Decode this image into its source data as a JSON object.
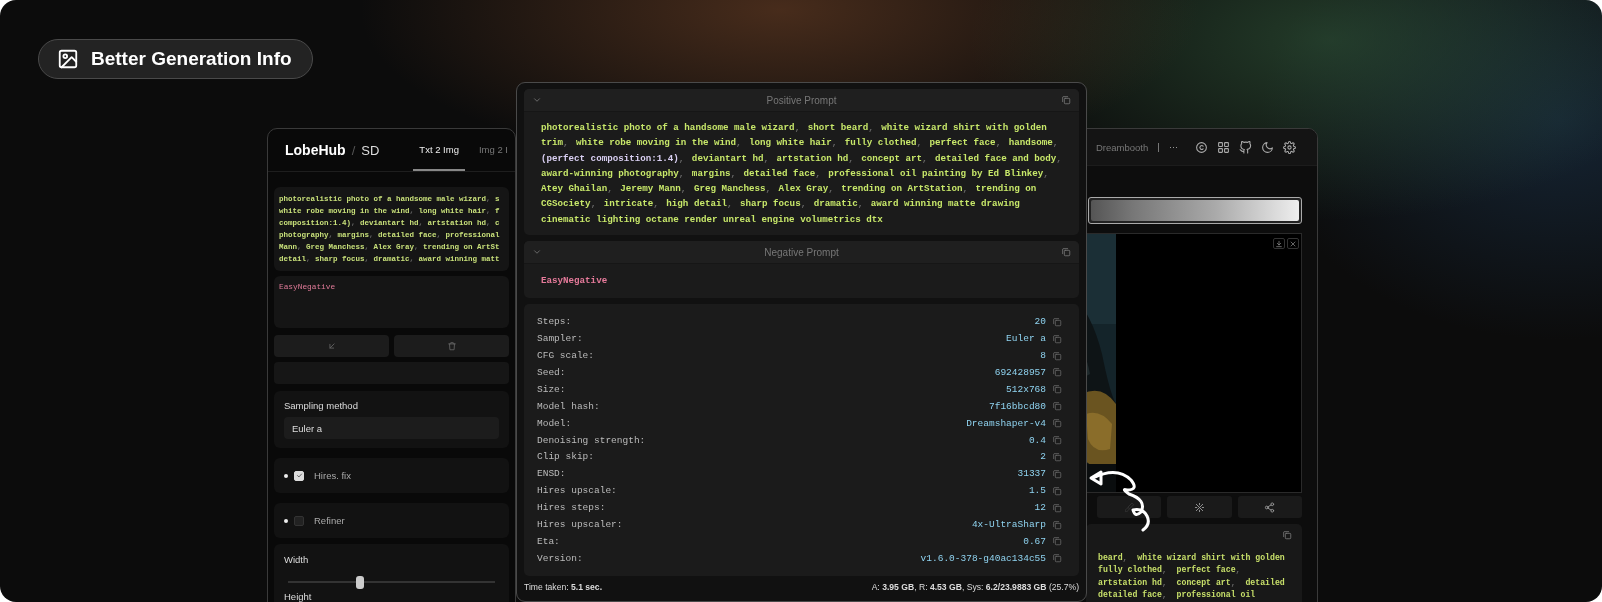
{
  "badge": {
    "label": "Better Generation Info"
  },
  "left_window": {
    "brand": "LobeHub",
    "separator": "/",
    "product": "SD",
    "tabs": [
      {
        "label": "Txt 2 Img",
        "selected": true
      },
      {
        "label": "Img 2 I",
        "selected": false
      }
    ],
    "prompt_lines": [
      "photorealistic photo of a handsome male wizard, s",
      "white robe moving in the wind, long white hair, f",
      "composition:1.4), deviantart hd, artstation hd, c",
      "photography, margins, detailed face, professional",
      "Mann, Greg Manchess, Alex Gray, trending on ArtSt",
      "detail, sharp focus, dramatic, award winning matt"
    ],
    "negative_prompt": "EasyNegative",
    "sampling": {
      "label": "Sampling method",
      "value": "Euler a"
    },
    "toggles": [
      {
        "label": "Hires. fix",
        "checked": true
      },
      {
        "label": "Refiner",
        "checked": false
      }
    ],
    "size": {
      "width_label": "Width",
      "level": 0.35,
      "height_label": "Height"
    }
  },
  "info_window": {
    "sections": [
      {
        "title": "Positive Prompt",
        "kind": "positive",
        "text": "photorealistic photo of a handsome male wizard, short beard, white wizard shirt with golden trim, white robe moving in the wind, long white hair, fully clothed, perfect face, handsome, (perfect composition:1.4), deviantart hd, artstation hd, concept art, detailed face and body, award-winning photography, margins, detailed face, professional oil painting by Ed Blinkey, Atey Ghailan, Jeremy Mann, Greg Manchess, Alex Gray, trending on ArtStation, trending on CGSociety, intricate, high detail, sharp focus, dramatic, award winning matte drawing cinematic lighting octane render unreal engine volumetrics dtx"
      },
      {
        "title": "Negative Prompt",
        "kind": "negative",
        "text": "EasyNegative"
      }
    ],
    "params": [
      {
        "label": "Steps:",
        "value": "20"
      },
      {
        "label": "Sampler:",
        "value": "Euler a"
      },
      {
        "label": "CFG scale:",
        "value": "8"
      },
      {
        "label": "Seed:",
        "value": "692428957"
      },
      {
        "label": "Size:",
        "value": "512x768"
      },
      {
        "label": "Model hash:",
        "value": "7f16bbcd80"
      },
      {
        "label": "Model:",
        "value": "Dreamshaper-v4"
      },
      {
        "label": "Denoising strength:",
        "value": "0.4"
      },
      {
        "label": "Clip skip:",
        "value": "2"
      },
      {
        "label": "ENSD:",
        "value": "31337"
      },
      {
        "label": "Hires upscale:",
        "value": "1.5"
      },
      {
        "label": "Hires steps:",
        "value": "12"
      },
      {
        "label": "Hires upscaler:",
        "value": "4x-UltraSharp"
      },
      {
        "label": "Eta:",
        "value": "0.67"
      },
      {
        "label": "Version:",
        "value": "v1.6.0-378-g40ac134c55"
      }
    ],
    "footer": {
      "time": "Time taken: **5.1 sec.**",
      "memory": "A: **3.95 GB**, R: **4.53 GB**, Sys: **6.2/23.9883 GB** (25.7%)"
    }
  },
  "right_window": {
    "tab": "Dreambooth",
    "more": "···",
    "progress": {
      "level": 1
    },
    "prompt_lines": [
      "beard,  white wizard shirt with golden",
      "fully clothed,  perfect face,",
      "artstation hd,  concept art,  detailed",
      "detailed face,  professional oil"
    ]
  }
}
